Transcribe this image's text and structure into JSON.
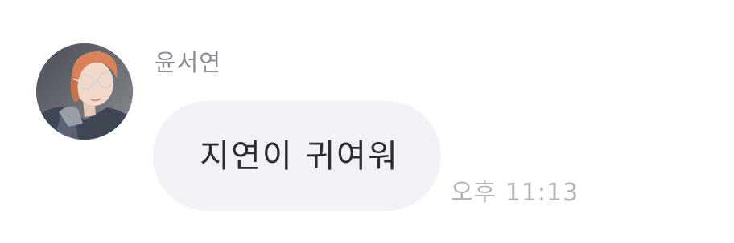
{
  "message": {
    "sender_name": "윤서연",
    "text": "지연이 귀여워",
    "timestamp": "오후 11:13",
    "avatar_icon": "profile-photo"
  },
  "colors": {
    "bubble_background": "#f2f2f6",
    "name_text": "#8b8e96",
    "message_text": "#2c2c30",
    "timestamp_text": "#b3b5ba"
  }
}
